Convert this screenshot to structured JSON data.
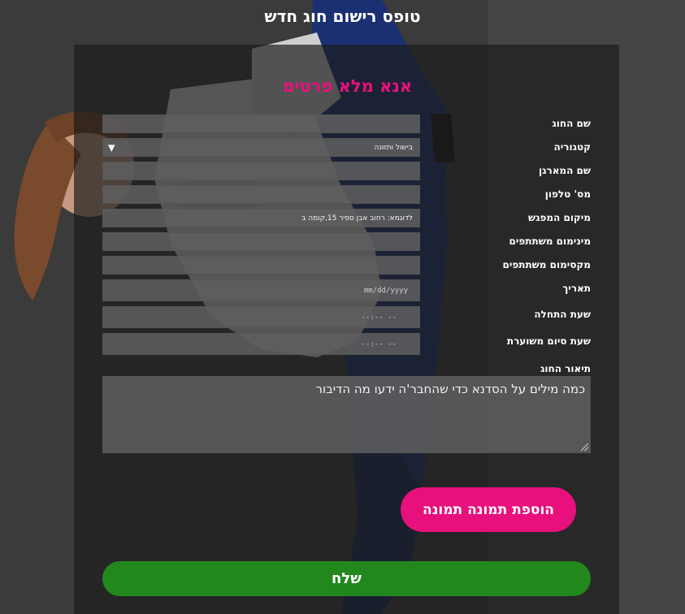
{
  "page": {
    "title": "טופס רישום חוג חדש"
  },
  "form": {
    "subtitle": "אנא מלא פרטים",
    "labels": {
      "name": "שם החוג",
      "category": "קטגוריה",
      "organizer": "שם המארגן",
      "phone": "מס' טלפון",
      "location": "מיקום המפגש",
      "min": "מינימום משתתפים",
      "max": "מקסימום משתתפים",
      "date": "תאריך",
      "start": "שעת התחלה",
      "end": "שעת סיום משוערת",
      "description": "תיאור החוג"
    },
    "category_selected": "בישול ותזונה",
    "location_placeholder": "לדוגמא: רחוב אבן ספיר 15,קומה ב",
    "date_placeholder": "mm/dd/yyyy",
    "start_placeholder": "--:-- --",
    "end_placeholder": "--:-- --",
    "description_placeholder": "כמה מילים על הסדנא כדי שהחבר'ה ידעו מה הדיבור",
    "add_photo_label": "הוספת תמונה תמונה",
    "submit_label": "שלח"
  },
  "colors": {
    "accent": "#e8107c",
    "submit": "#22881e",
    "panel": "#1c1c1c"
  }
}
